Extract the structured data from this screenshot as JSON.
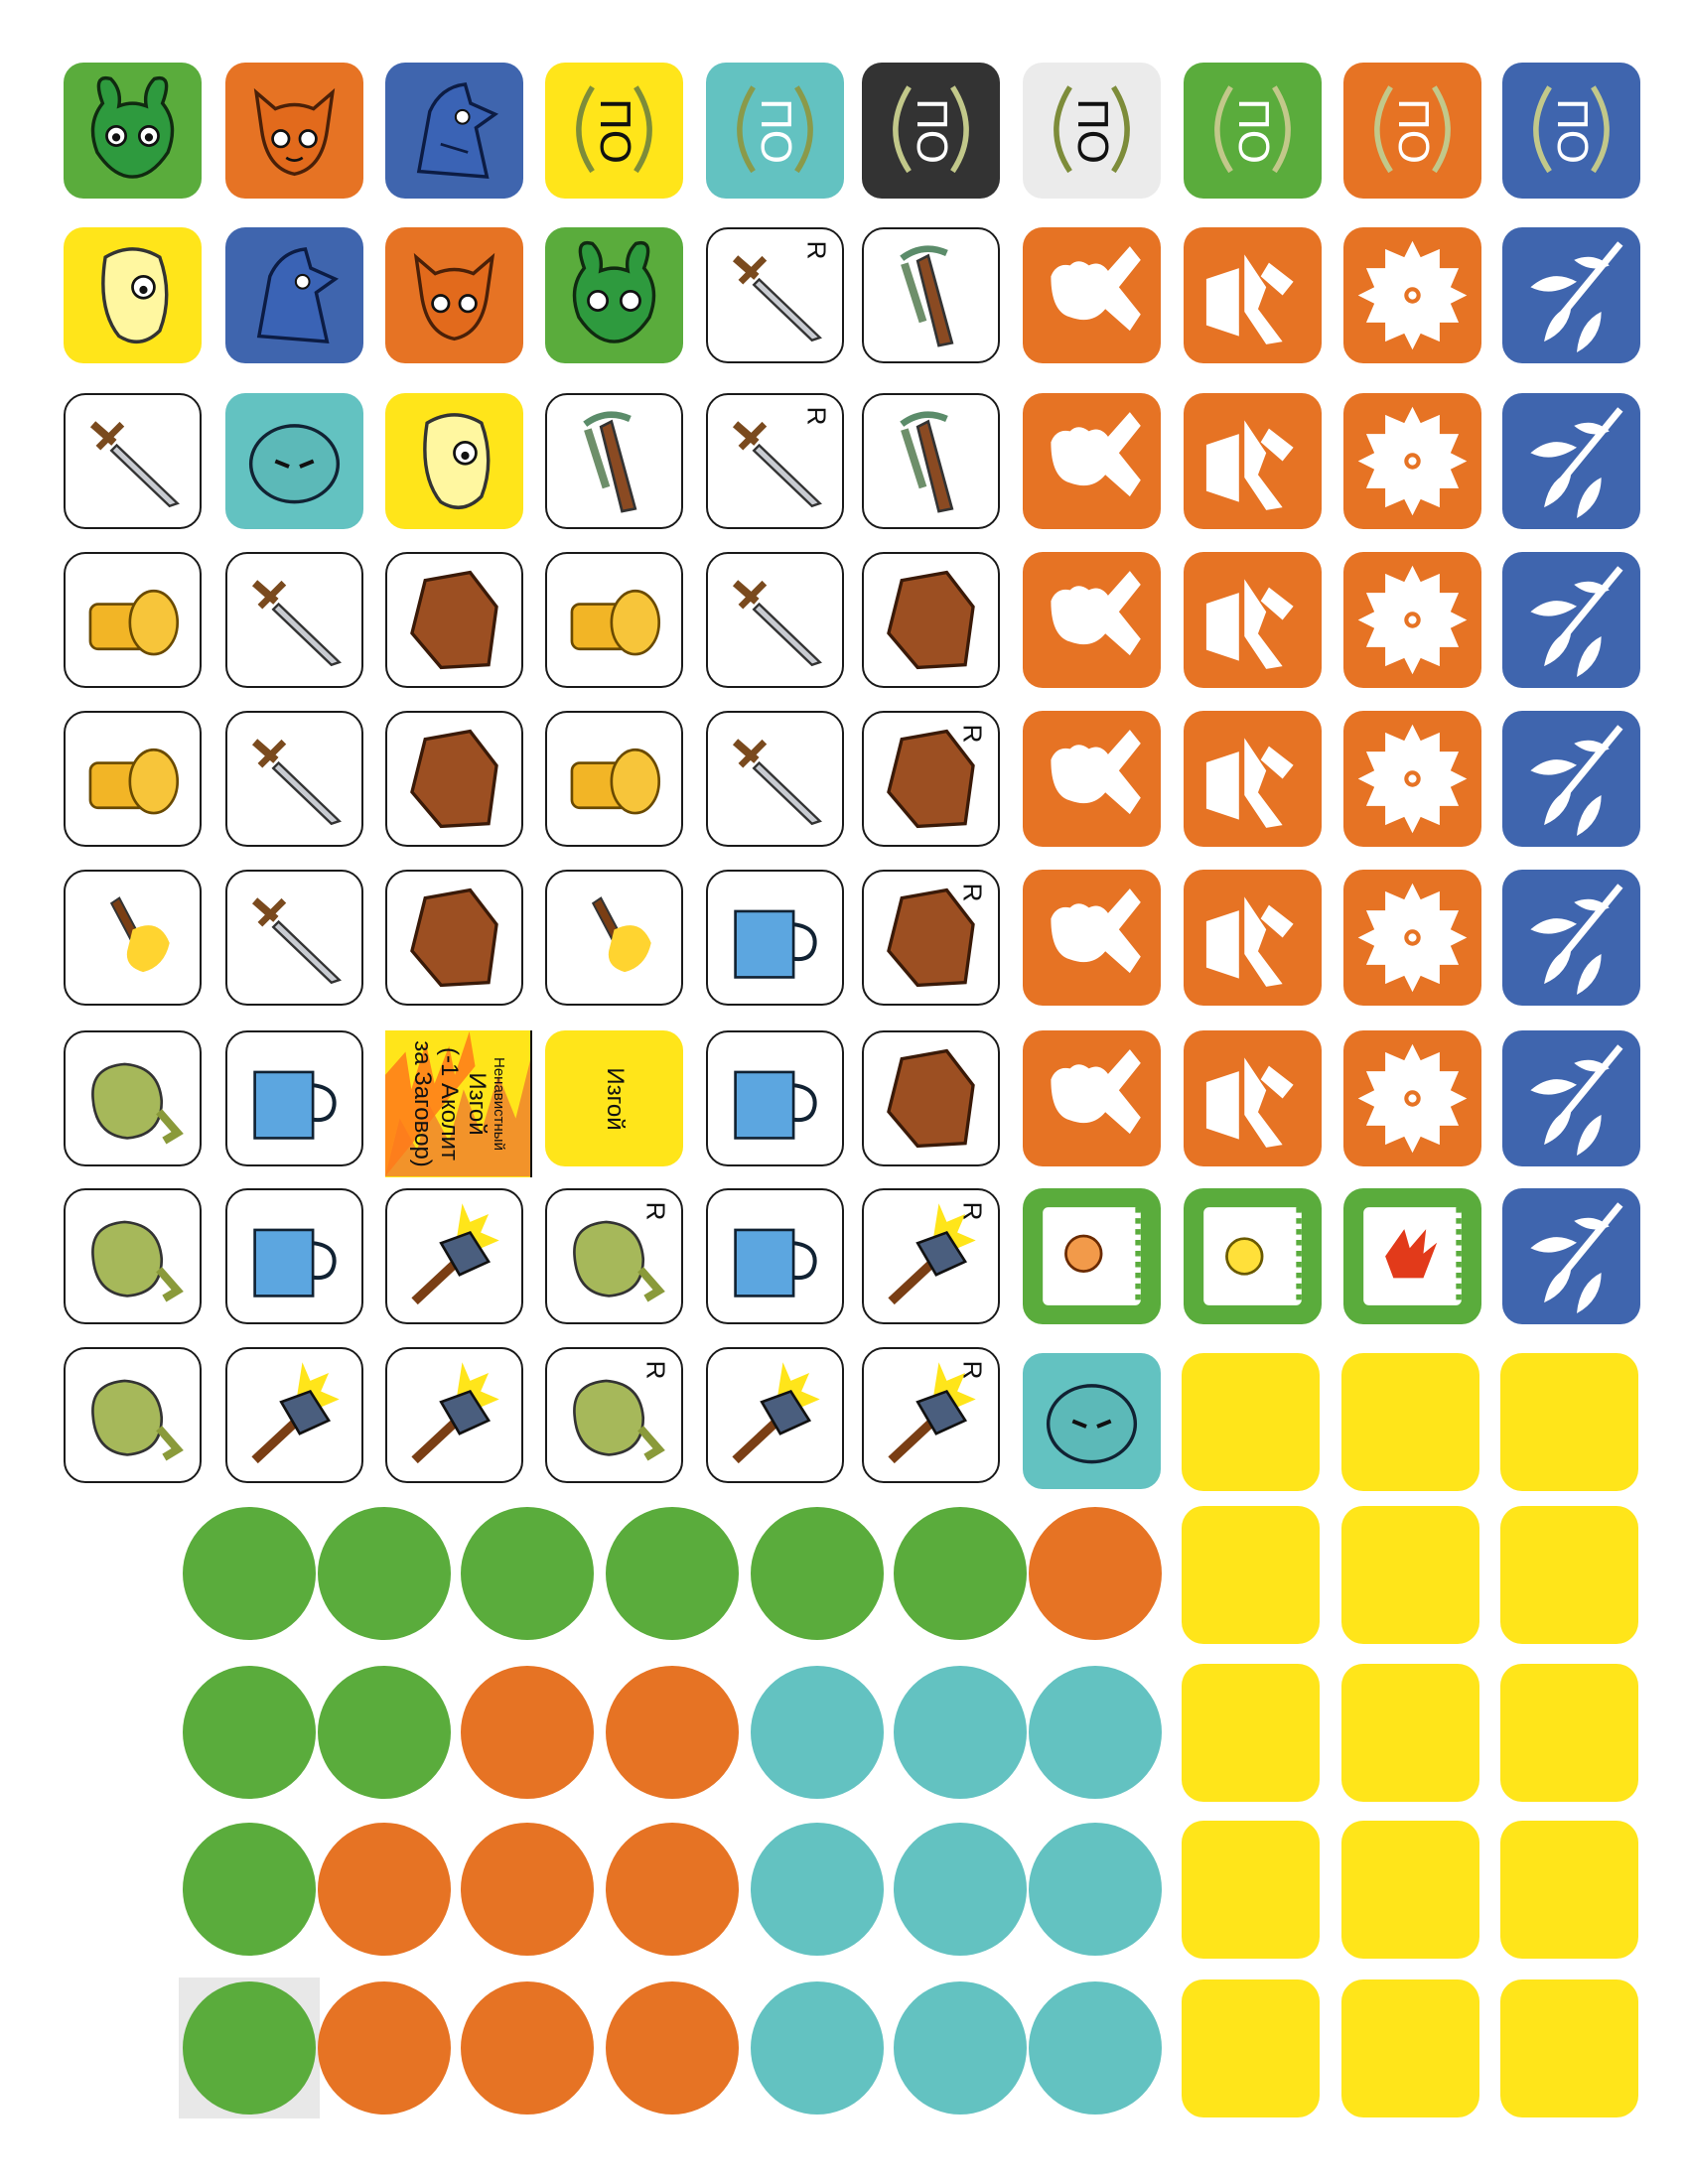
{
  "colors": {
    "green": "#5aac3c",
    "orange": "#e67324",
    "blue": "#3f65ae",
    "yellow": "#ffe51a",
    "teal": "#63c2c1",
    "dark": "#333333",
    "light": "#ebebeb",
    "light_yellow": "#fff27a"
  },
  "labels": {
    "po": "ПО",
    "r": "R",
    "izgoi": "Изгой",
    "card": {
      "line1": "Ненавистный",
      "line2": "Изгой",
      "line3": "(-1 Аколит",
      "line4": "за Заговор)"
    }
  },
  "icons": [
    "rabbit-face-icon",
    "fox-face-icon",
    "bird-face-icon",
    "laurel-wreath-icon",
    "lizard-face-icon",
    "dagger-icon",
    "crossbow-icon",
    "owl-face-icon",
    "coins-icon",
    "leather-armor-icon",
    "torch-icon",
    "teapot-icon",
    "sack-icon",
    "hammer-icon",
    "fist-icon",
    "hammer-shield-icon",
    "sawblade-icon",
    "leaf-branch-icon",
    "banner-icon",
    "ruins-icon",
    "logs-icon",
    "signpost-icon",
    "vine-pattern-icon",
    "city-icon"
  ]
}
